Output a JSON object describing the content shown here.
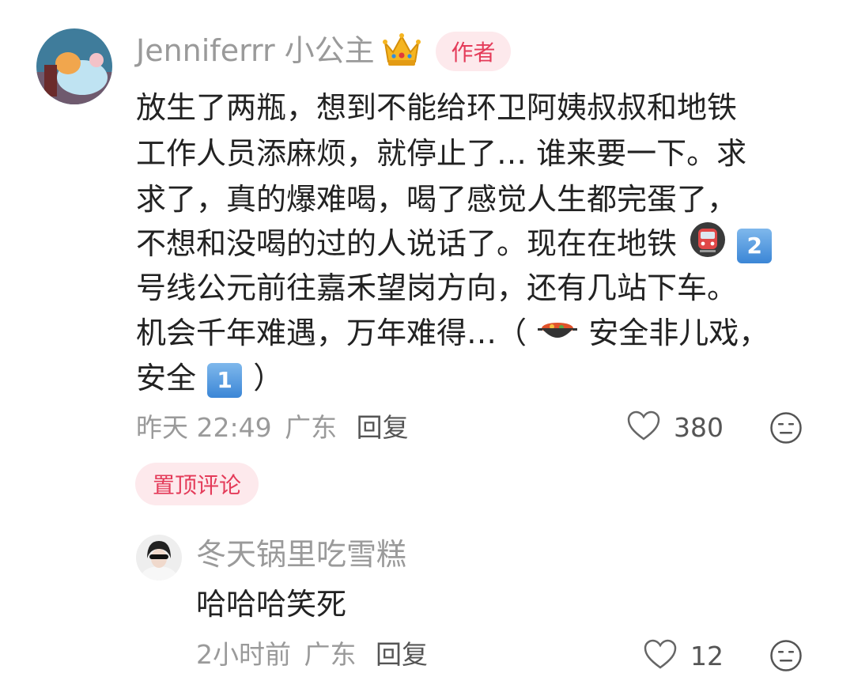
{
  "comment": {
    "username": "Jenniferrr 小公主",
    "crown_icon": "crown-icon",
    "author_badge": "作者",
    "lines": [
      "放生了两瓶，想到不能给环卫阿姨叔叔和地铁",
      "工作人员添麻烦，就停止了… 谁来要一下。求",
      "求了，真的爆难喝，喝了感觉人生都完蛋了，",
      "不想和没喝的过的人说话了。现在在地铁",
      "号线公元前往嘉禾望岗方向，还有几站下车。",
      "机会千年难遇，万年难得…（",
      "安全非儿戏，",
      "安全",
      "）"
    ],
    "emoji_two": "2",
    "emoji_one": "1",
    "time": "昨天 22:49",
    "location": "广东",
    "reply": "回复",
    "likes": "380",
    "pinned_label": "置顶评论"
  },
  "reply_comment": {
    "username": "冬天锅里吃雪糕",
    "text": "哈哈哈笑死",
    "time": "2小时前",
    "location": "广东",
    "reply": "回复",
    "likes": "12"
  },
  "colors": {
    "accent": "#e43b59",
    "badge_bg": "#fde9ec",
    "meta_gray": "#9a9a9a"
  }
}
